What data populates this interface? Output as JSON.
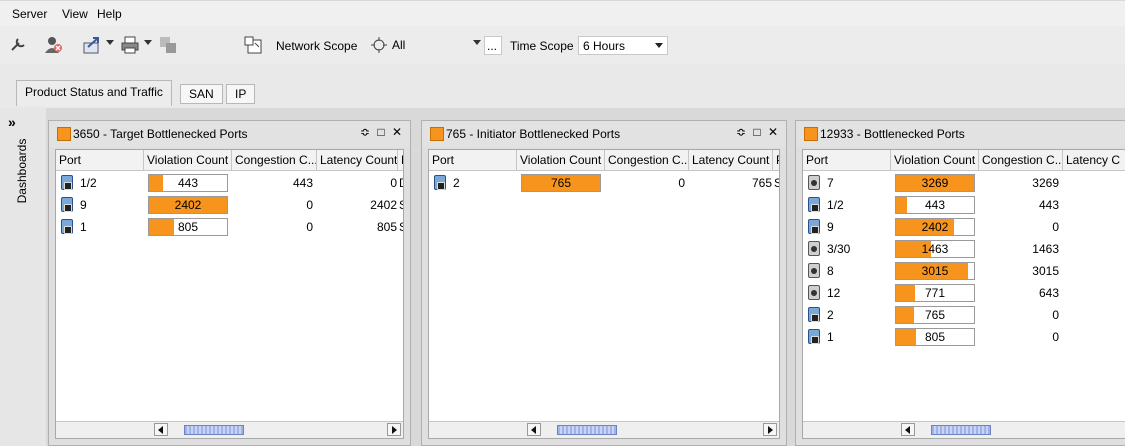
{
  "menu": {
    "server": "Server",
    "view": "View",
    "help": "Help"
  },
  "toolbar": {
    "network_scope_label": "Network Scope",
    "network_scope_value": "All",
    "network_scope_more": "...",
    "time_scope_label": "Time Scope",
    "time_scope_value": "6 Hours"
  },
  "tabs": {
    "main": "Product Status and Traffic",
    "san": "SAN",
    "ip": "IP"
  },
  "sidebar": {
    "chevron": "»",
    "label": "Dashboards"
  },
  "colors": {
    "accent": "#f7941d",
    "bar_fill": "#f7941d"
  },
  "panels": [
    {
      "title": "3650 - Target Bottlenecked Ports",
      "controls": "≎ □ ✕",
      "columns": [
        "Port",
        "Violation Count",
        "Congestion C...",
        "Latency Count",
        "P"
      ],
      "rows": [
        {
          "icon": "blue-port-icon",
          "port": "1/2",
          "violation": "443",
          "fill": 0.18,
          "congestion": "443",
          "latency": "0",
          "extra": "D"
        },
        {
          "icon": "blue-port-icon",
          "port": "9",
          "violation": "2402",
          "fill": 1.0,
          "congestion": "0",
          "latency": "2402",
          "extra": "S"
        },
        {
          "icon": "blue-port-icon",
          "port": "1",
          "violation": "805",
          "fill": 0.32,
          "congestion": "0",
          "latency": "805",
          "extra": "S"
        }
      ]
    },
    {
      "title": "765 - Initiator Bottlenecked Ports",
      "controls": "≎ □ ✕",
      "columns": [
        "Port",
        "Violation Count",
        "Congestion C...",
        "Latency Count",
        "P"
      ],
      "rows": [
        {
          "icon": "blue-port-icon",
          "port": "2",
          "violation": "765",
          "fill": 1.0,
          "congestion": "0",
          "latency": "765",
          "extra": "S"
        }
      ]
    },
    {
      "title": "12933 - Bottlenecked Ports",
      "columns": [
        "Port",
        "Violation Count",
        "Congestion C...",
        "Latency C"
      ],
      "rows": [
        {
          "icon": "gray-port-icon",
          "port": "7",
          "violation": "3269",
          "fill": 1.0,
          "congestion": "3269"
        },
        {
          "icon": "blue-port-icon",
          "port": "1/2",
          "violation": "443",
          "fill": 0.14,
          "congestion": "443"
        },
        {
          "icon": "blue-port-icon",
          "port": "9",
          "violation": "2402",
          "fill": 0.74,
          "congestion": "0"
        },
        {
          "icon": "gray-port-icon",
          "port": "3/30",
          "violation": "1463",
          "fill": 0.45,
          "congestion": "1463"
        },
        {
          "icon": "gray-port-icon",
          "port": "8",
          "violation": "3015",
          "fill": 0.92,
          "congestion": "3015"
        },
        {
          "icon": "gray-port-icon",
          "port": "12",
          "violation": "771",
          "fill": 0.24,
          "congestion": "643"
        },
        {
          "icon": "blue-port-icon",
          "port": "2",
          "violation": "765",
          "fill": 0.23,
          "congestion": "0"
        },
        {
          "icon": "blue-port-icon",
          "port": "1",
          "violation": "805",
          "fill": 0.25,
          "congestion": "0"
        }
      ]
    }
  ]
}
